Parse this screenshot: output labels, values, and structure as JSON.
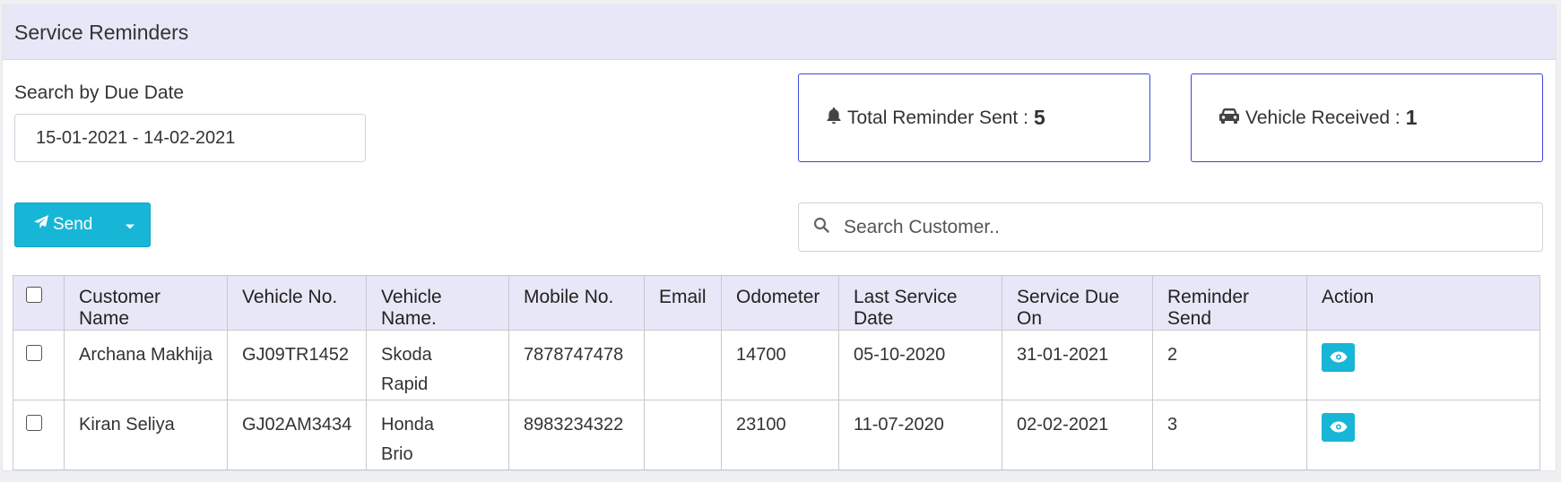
{
  "panel": {
    "title": "Service Reminders"
  },
  "filters": {
    "search_label": "Search by Due Date",
    "date_range": "15-01-2021 - 14-02-2021"
  },
  "stats": {
    "total_label": "Total Reminder Sent :",
    "total_value": "5",
    "vehicle_label": "Vehicle Received :",
    "vehicle_value": "1"
  },
  "actions": {
    "send_label": "Send"
  },
  "search": {
    "placeholder": "Search Customer.."
  },
  "table": {
    "headers": [
      "Customer Name",
      "Vehicle No.",
      "Vehicle Name.",
      "Mobile No.",
      "Email",
      "Odometer",
      "Last Service Date",
      "Service Due On",
      "Reminder Send",
      "Action"
    ],
    "rows": [
      {
        "customer": "Archana Makhija",
        "vehicle_no": "GJ09TR1452",
        "vehicle_name_1": "Skoda",
        "vehicle_name_2": "Rapid",
        "mobile": "7878747478",
        "email": "",
        "odometer": "14700",
        "last_service": "05-10-2020",
        "due_on": "31-01-2021",
        "reminder_send": "2"
      },
      {
        "customer": "Kiran Seliya",
        "vehicle_no": "GJ02AM3434",
        "vehicle_name_1": "Honda",
        "vehicle_name_2": "Brio",
        "mobile": "8983234322",
        "email": "",
        "odometer": "23100",
        "last_service": "11-07-2020",
        "due_on": "02-02-2021",
        "reminder_send": "3"
      }
    ]
  },
  "colors": {
    "accent": "#17b6d6",
    "header_bg": "#e7e7f7",
    "stat_border": "#3b46d9"
  },
  "icons": {
    "bell": "bell-icon",
    "car": "car-icon",
    "send": "paper-plane-icon",
    "caret": "caret-down-icon",
    "search": "search-icon",
    "view": "eye-icon"
  }
}
